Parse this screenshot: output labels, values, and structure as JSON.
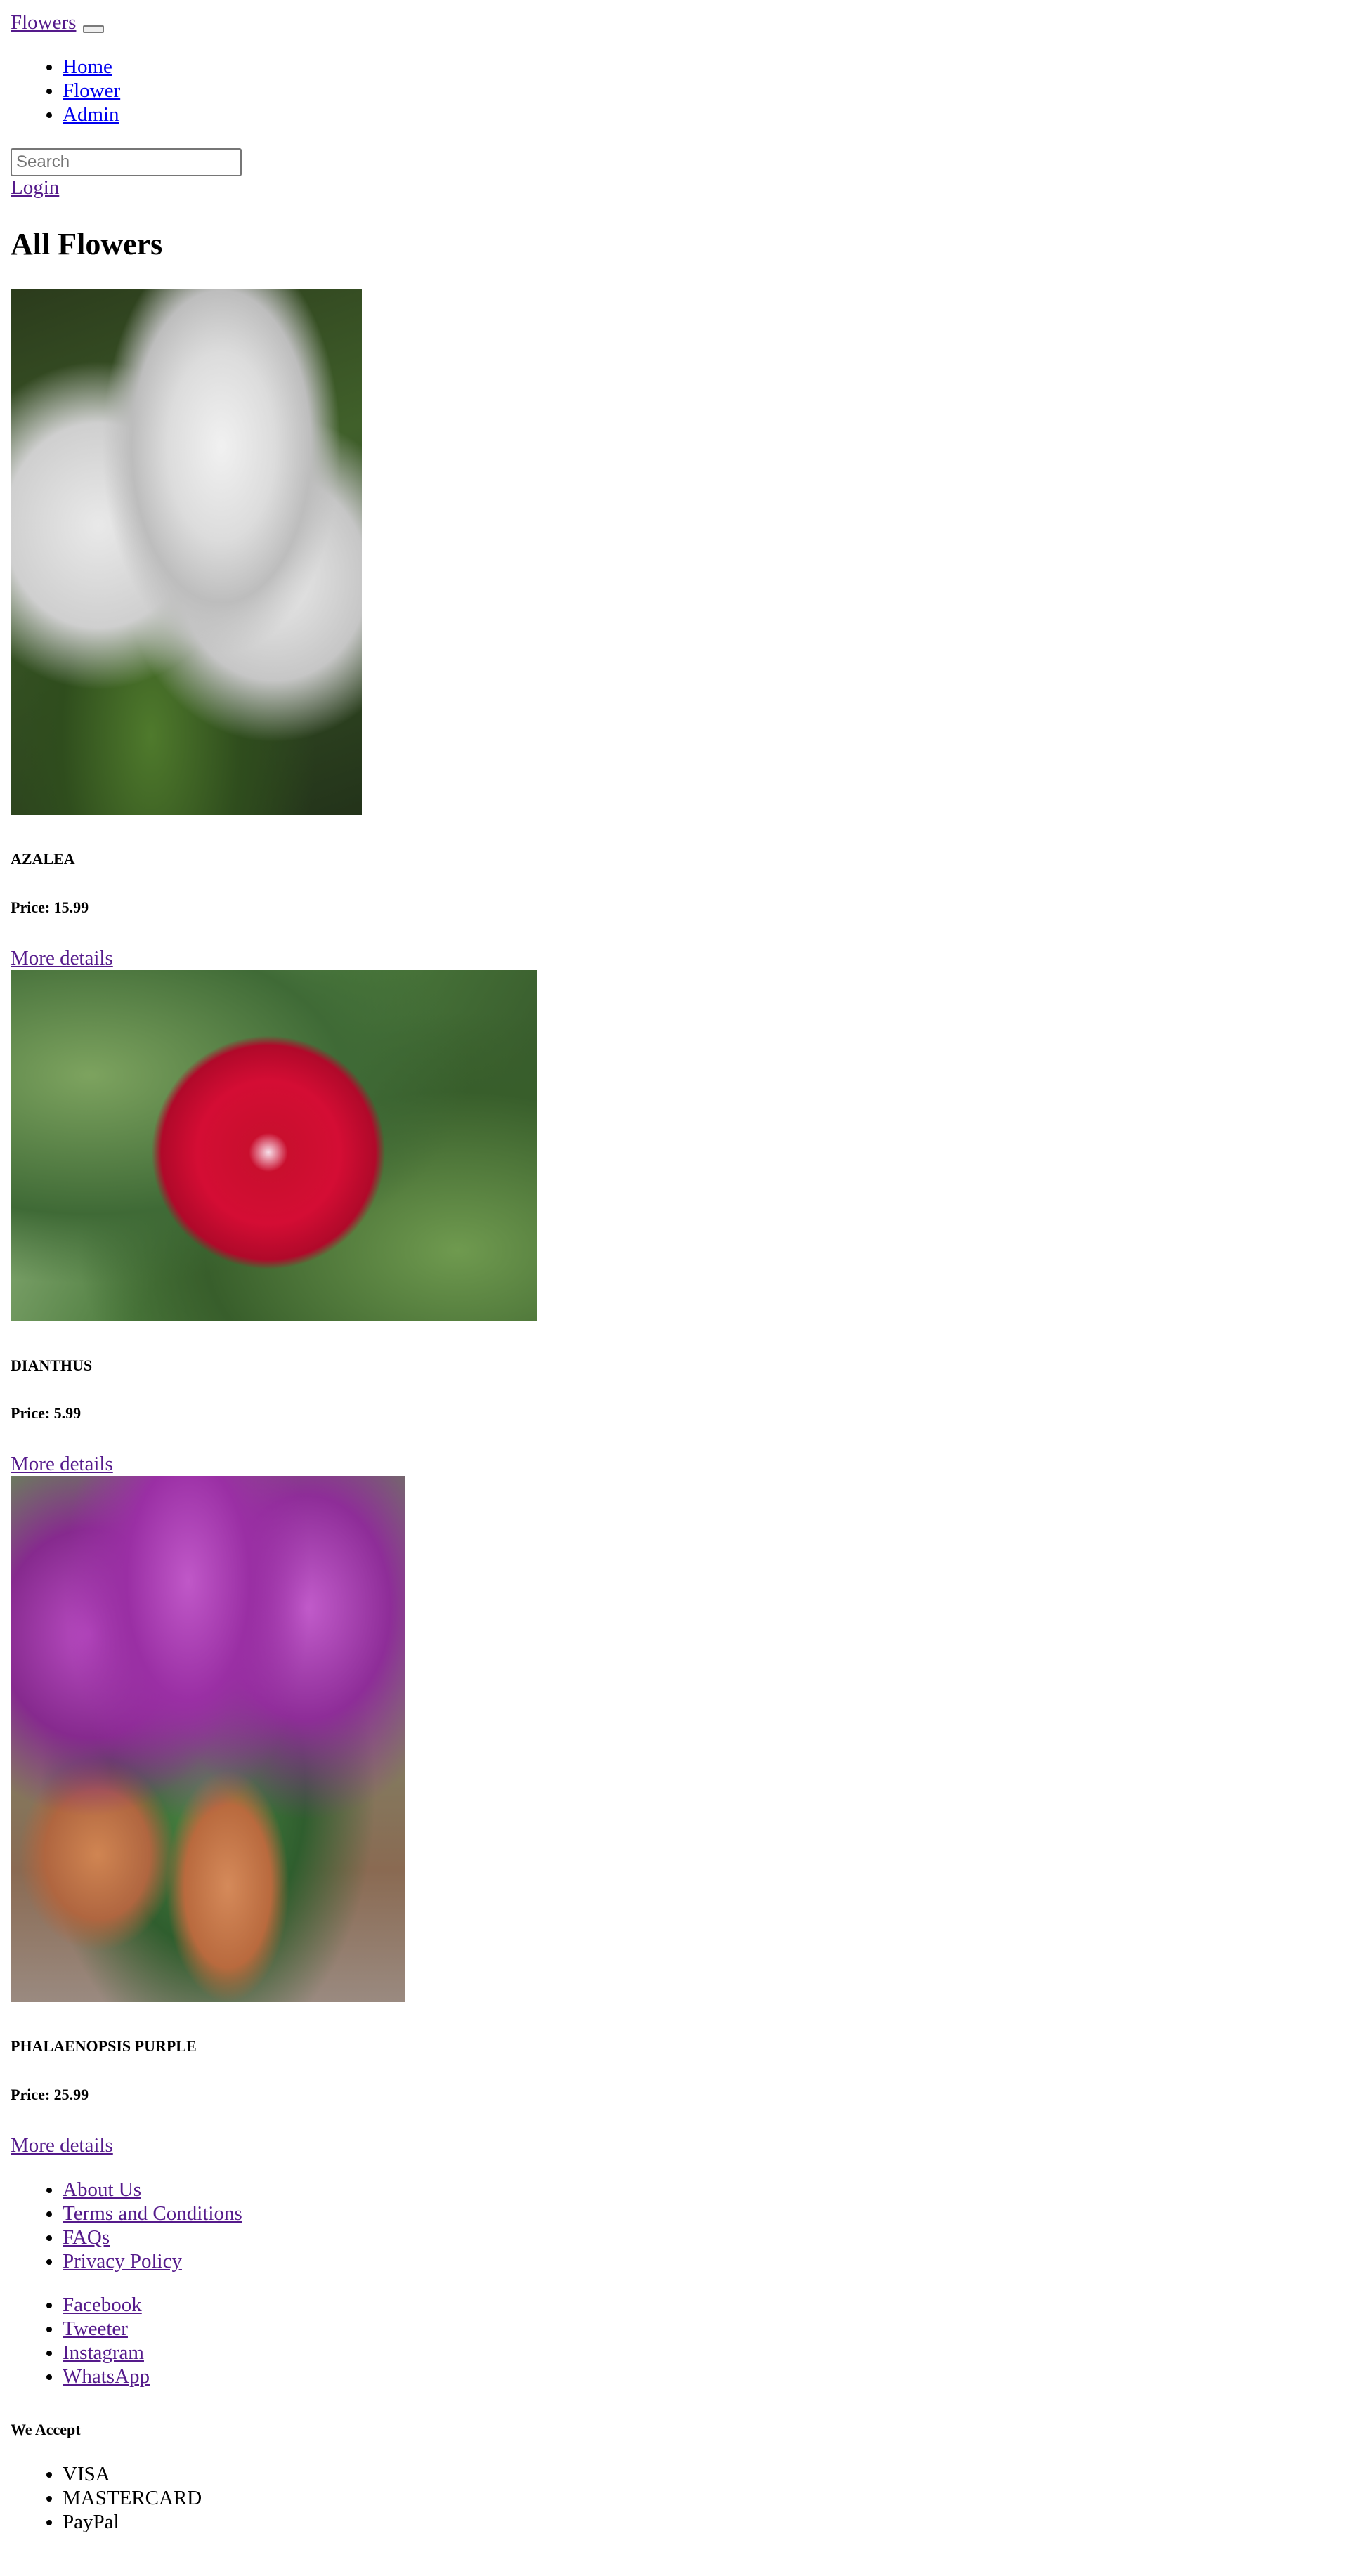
{
  "header": {
    "brand": "Flowers",
    "toggler_icon": "menu-toggle-icon",
    "nav": [
      "Home",
      "Flower",
      "Admin"
    ],
    "search_placeholder": "Search",
    "login_label": "Login"
  },
  "main": {
    "title": "All Flowers",
    "products": [
      {
        "name": "AZALEA",
        "price": "Price: 15.99",
        "details_label": "More details"
      },
      {
        "name": "DIANTHUS",
        "price": "Price: 5.99",
        "details_label": "More details"
      },
      {
        "name": "PHALAENOPSIS PURPLE",
        "price": "Price: 25.99",
        "details_label": "More details"
      }
    ]
  },
  "footer": {
    "info_links": [
      "About Us",
      "Terms and Conditions",
      "FAQs",
      "Privacy Policy"
    ],
    "social_links": [
      "Facebook",
      "Tweeter",
      "Instagram",
      "WhatsApp"
    ],
    "payments_heading": "We Accept",
    "payments": [
      "VISA",
      "MASTERCARD",
      "PayPal"
    ]
  },
  "colors": {
    "visited_link": "#551a8b",
    "unvisited_link": "#0000ee",
    "text": "#000000",
    "background": "#ffffff"
  }
}
